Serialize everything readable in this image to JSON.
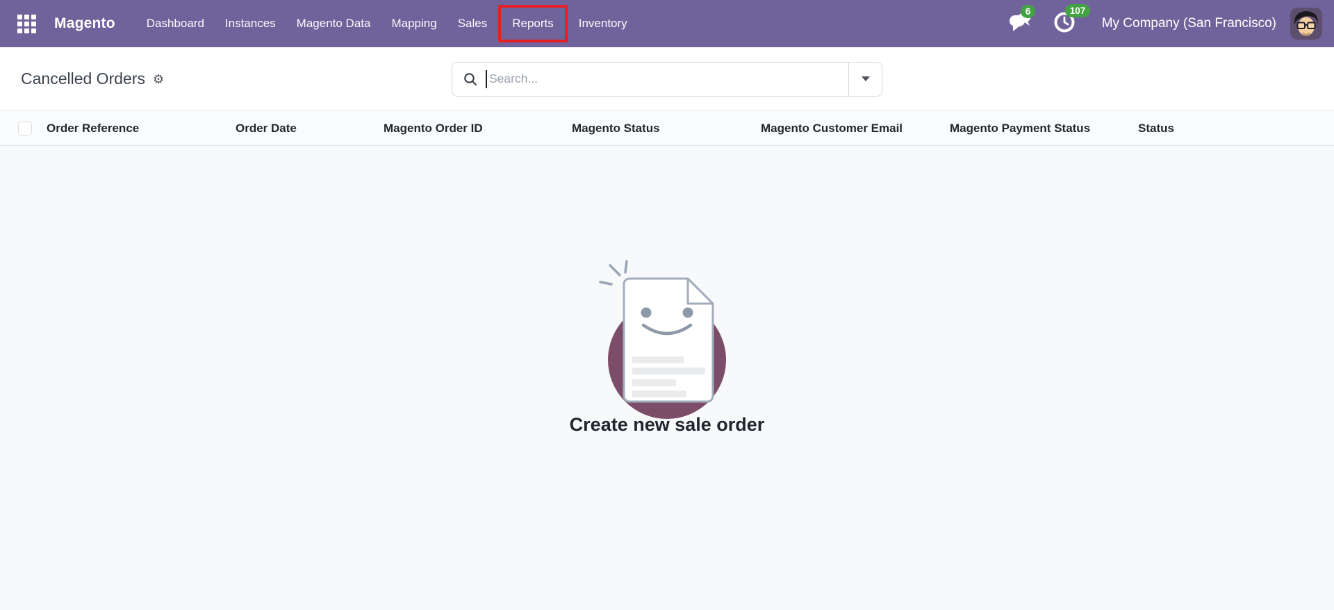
{
  "navbar": {
    "brand": "Magento",
    "menu": [
      "Dashboard",
      "Instances",
      "Magento Data",
      "Mapping",
      "Sales",
      "Reports",
      "Inventory"
    ],
    "highlighted_item": "Reports",
    "messages_badge": "6",
    "activities_badge": "107",
    "company": "My Company (San Francisco)"
  },
  "control_panel": {
    "title": "Cancelled Orders",
    "gear_glyph": "⚙",
    "search_placeholder": "Search..."
  },
  "table": {
    "columns": [
      "Order Reference",
      "Order Date",
      "Magento Order ID",
      "Magento Status",
      "Magento Customer Email",
      "Magento Payment Status",
      "Status"
    ]
  },
  "empty_state": {
    "message": "Create new sale order"
  },
  "colors": {
    "navbar_purple": "#70639c",
    "annotation_red": "#e71e25",
    "badge_green": "#41a341",
    "illustration_plum": "#7c4d68",
    "content_bg": "#f8f9fa"
  }
}
